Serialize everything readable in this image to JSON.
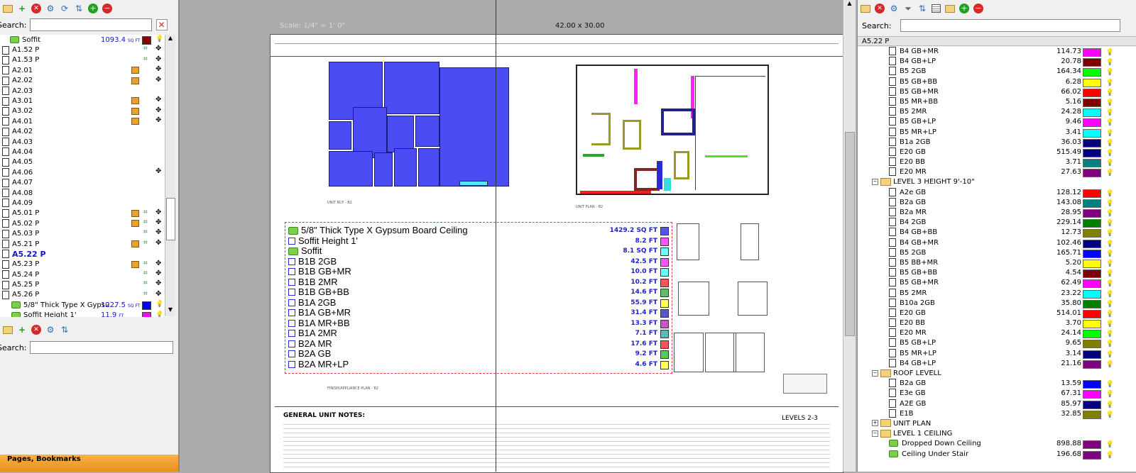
{
  "left_panel": {
    "search_label": "Search:",
    "search_value": "",
    "search2_label": "Search:",
    "pages_tab": "Pages, Bookmarks",
    "items": [
      {
        "name": "Soffit",
        "value": "1093.4",
        "unit": "SQ FT",
        "color": "#8b0000",
        "type": "folder",
        "bold": false
      },
      {
        "name": "A1.52 P",
        "type": "page"
      },
      {
        "name": "A1.53 P",
        "type": "page"
      },
      {
        "name": "A2.01",
        "type": "page"
      },
      {
        "name": "A2.02",
        "type": "page"
      },
      {
        "name": "A2.03",
        "type": "page"
      },
      {
        "name": "A3.01",
        "type": "page"
      },
      {
        "name": "A3.02",
        "type": "page"
      },
      {
        "name": "A4.01",
        "type": "page"
      },
      {
        "name": "A4.02",
        "type": "page"
      },
      {
        "name": "A4.03",
        "type": "page"
      },
      {
        "name": "A4.04",
        "type": "page"
      },
      {
        "name": "A4.05",
        "type": "page"
      },
      {
        "name": "A4.06",
        "type": "page"
      },
      {
        "name": "A4.07",
        "type": "page"
      },
      {
        "name": "A4.08",
        "type": "page"
      },
      {
        "name": "A4.09",
        "type": "page"
      },
      {
        "name": "A5.01 P",
        "type": "page"
      },
      {
        "name": "A5.02 P",
        "type": "page"
      },
      {
        "name": "A5.03 P",
        "type": "page"
      },
      {
        "name": "A5.21 P",
        "type": "page"
      },
      {
        "name": "A5.22 P",
        "type": "page",
        "bold": true
      },
      {
        "name": "A5.23 P",
        "type": "page"
      },
      {
        "name": "A5.24 P",
        "type": "page"
      },
      {
        "name": "A5.25 P",
        "type": "page"
      },
      {
        "name": "A5.26 P",
        "type": "page"
      },
      {
        "name": "5/8\" Thick Type X Gypsu...",
        "value": "1227.5",
        "unit": "SQ FT",
        "color": "#0000ff",
        "type": "folder"
      },
      {
        "name": "Soffit Height 1'",
        "value": "11.9",
        "unit": "FT",
        "color": "#ff00ff",
        "type": "folder"
      }
    ]
  },
  "document": {
    "scale_label": "Scale: 1/4\" = 1' 0\"",
    "size_label": "42.00 x 30.00",
    "general_notes_title": "GENERAL UNIT NOTES:",
    "levels_label": "LEVELS 2-3",
    "markup_list": [
      {
        "label": "5/8\" Thick Type X Gypsum Board Ceiling",
        "value": "1429.2 SQ FT",
        "color": "#5555ee",
        "folder": true
      },
      {
        "label": "Soffit Height 1'",
        "value": "8.2 FT",
        "color": "#ff55ff",
        "folder": false
      },
      {
        "label": "Soffit",
        "value": "8.1 SQ FT",
        "color": "#66ffff",
        "folder": true
      },
      {
        "label": "B1B 2GB",
        "value": "42.5 FT",
        "color": "#ff55ff",
        "folder": false
      },
      {
        "label": "B1B GB+MR",
        "value": "10.0 FT",
        "color": "#66ffff",
        "folder": false
      },
      {
        "label": "B1B 2MR",
        "value": "10.2 FT",
        "color": "#ff5555",
        "folder": false
      },
      {
        "label": "B1B GB+BB",
        "value": "14.6 FT",
        "color": "#66bb66",
        "folder": false
      },
      {
        "label": "B1A 2GB",
        "value": "55.9 FT",
        "color": "#ffff55",
        "folder": false
      },
      {
        "label": "B1A GB+MR",
        "value": "31.4 FT",
        "color": "#5555cc",
        "folder": false
      },
      {
        "label": "B1A MR+BB",
        "value": "13.3 FT",
        "color": "#cc55cc",
        "folder": false
      },
      {
        "label": "B1A 2MR",
        "value": "7.1 FT",
        "color": "#55bbbb",
        "folder": false
      },
      {
        "label": "B2A MR",
        "value": "17.6 FT",
        "color": "#ff5555",
        "folder": false
      },
      {
        "label": "B2A GB",
        "value": "9.2 FT",
        "color": "#55cc55",
        "folder": false
      },
      {
        "label": "B2A MR+LP",
        "value": "4.6 FT",
        "color": "#ffff55",
        "folder": false
      }
    ]
  },
  "right_panel": {
    "search_label": "Search:",
    "search_value": "",
    "header": "A5.22 P",
    "rows": [
      {
        "kind": "item",
        "name": "B4 GB+MR",
        "value": "114.73",
        "color": "#ff00ff"
      },
      {
        "kind": "item",
        "name": "B4 GB+LP",
        "value": "20.78",
        "color": "#800000"
      },
      {
        "kind": "item",
        "name": "B5 2GB",
        "value": "164.34",
        "color": "#00ff00"
      },
      {
        "kind": "item",
        "name": "B5 GB+BB",
        "value": "6.28",
        "color": "#ffff00"
      },
      {
        "kind": "item",
        "name": "B5 GB+MR",
        "value": "66.02",
        "color": "#ff0000"
      },
      {
        "kind": "item",
        "name": "B5 MR+BB",
        "value": "5.16",
        "color": "#800000"
      },
      {
        "kind": "item",
        "name": "B5 2MR",
        "value": "24.28",
        "color": "#00ffff"
      },
      {
        "kind": "item",
        "name": "B5 GB+LP",
        "value": "9.46",
        "color": "#ff00ff"
      },
      {
        "kind": "item",
        "name": "B5 MR+LP",
        "value": "3.41",
        "color": "#00ffff"
      },
      {
        "kind": "item",
        "name": "B1a 2GB",
        "value": "36.03",
        "color": "#000080"
      },
      {
        "kind": "item",
        "name": "E20 GB",
        "value": "515.49",
        "color": "#000080"
      },
      {
        "kind": "item",
        "name": "E20 BB",
        "value": "3.71",
        "color": "#008080"
      },
      {
        "kind": "item",
        "name": "E20 MR",
        "value": "27.63",
        "color": "#800080"
      },
      {
        "kind": "folder",
        "name": "LEVEL 3 HEIGHT 9'-10\""
      },
      {
        "kind": "item",
        "name": "A2e GB",
        "value": "128.12",
        "color": "#ff0000"
      },
      {
        "kind": "item",
        "name": "B2a GB",
        "value": "143.08",
        "color": "#008080"
      },
      {
        "kind": "item",
        "name": "B2a MR",
        "value": "28.95",
        "color": "#800080"
      },
      {
        "kind": "item",
        "name": "B4 2GB",
        "value": "229.14",
        "color": "#008000"
      },
      {
        "kind": "item",
        "name": "B4 GB+BB",
        "value": "12.73",
        "color": "#808000"
      },
      {
        "kind": "item",
        "name": "B4 GB+MR",
        "value": "102.46",
        "color": "#000080"
      },
      {
        "kind": "item",
        "name": "B5 2GB",
        "value": "165.71",
        "color": "#0000ff"
      },
      {
        "kind": "item",
        "name": "B5 BB+MR",
        "value": "5.20",
        "color": "#ffff00"
      },
      {
        "kind": "item",
        "name": "B5 GB+BB",
        "value": "4.54",
        "color": "#800000"
      },
      {
        "kind": "item",
        "name": "B5 GB+MR",
        "value": "62.49",
        "color": "#ff00ff"
      },
      {
        "kind": "item",
        "name": "B5 2MR",
        "value": "23.22",
        "color": "#00ffff"
      },
      {
        "kind": "item",
        "name": "B10a 2GB",
        "value": "35.80",
        "color": "#008000"
      },
      {
        "kind": "item",
        "name": "E20 GB",
        "value": "514.01",
        "color": "#ff0000"
      },
      {
        "kind": "item",
        "name": "E20 BB",
        "value": "3.70",
        "color": "#ffff00"
      },
      {
        "kind": "item",
        "name": "E20 MR",
        "value": "24.14",
        "color": "#00ff00"
      },
      {
        "kind": "item",
        "name": "B5 GB+LP",
        "value": "9.65",
        "color": "#808000"
      },
      {
        "kind": "item",
        "name": "B5 MR+LP",
        "value": "3.14",
        "color": "#000080"
      },
      {
        "kind": "item",
        "name": "B4 GB+LP",
        "value": "21.16",
        "color": "#800080"
      },
      {
        "kind": "folder",
        "name": "ROOF LEVELL"
      },
      {
        "kind": "item",
        "name": "B2a GB",
        "value": "13.59",
        "color": "#0000ff"
      },
      {
        "kind": "item",
        "name": "E3e GB",
        "value": "67.31",
        "color": "#ff00ff"
      },
      {
        "kind": "item",
        "name": "A2E GB",
        "value": "85.97",
        "color": "#000080"
      },
      {
        "kind": "item",
        "name": "E1B",
        "value": "32.85",
        "color": "#808000"
      },
      {
        "kind": "folder-collapsed",
        "name": "UNIT PLAN"
      },
      {
        "kind": "folder",
        "name": "LEVEL 1 CEILING"
      },
      {
        "kind": "green",
        "name": "Dropped Down Ceiling",
        "value": "898.88",
        "color": "#800080"
      },
      {
        "kind": "green",
        "name": "Ceiling Under Stair",
        "value": "196.68",
        "color": "#800080"
      }
    ]
  },
  "icons": [
    "folder-icon",
    "add-icon",
    "delete-icon",
    "settings-icon",
    "refresh-icon",
    "sort-icon",
    "add-circle-icon",
    "remove-circle-icon",
    "filter-icon",
    "table-icon",
    "lightbulb-icon",
    "move-icon",
    "clear-search-icon"
  ]
}
